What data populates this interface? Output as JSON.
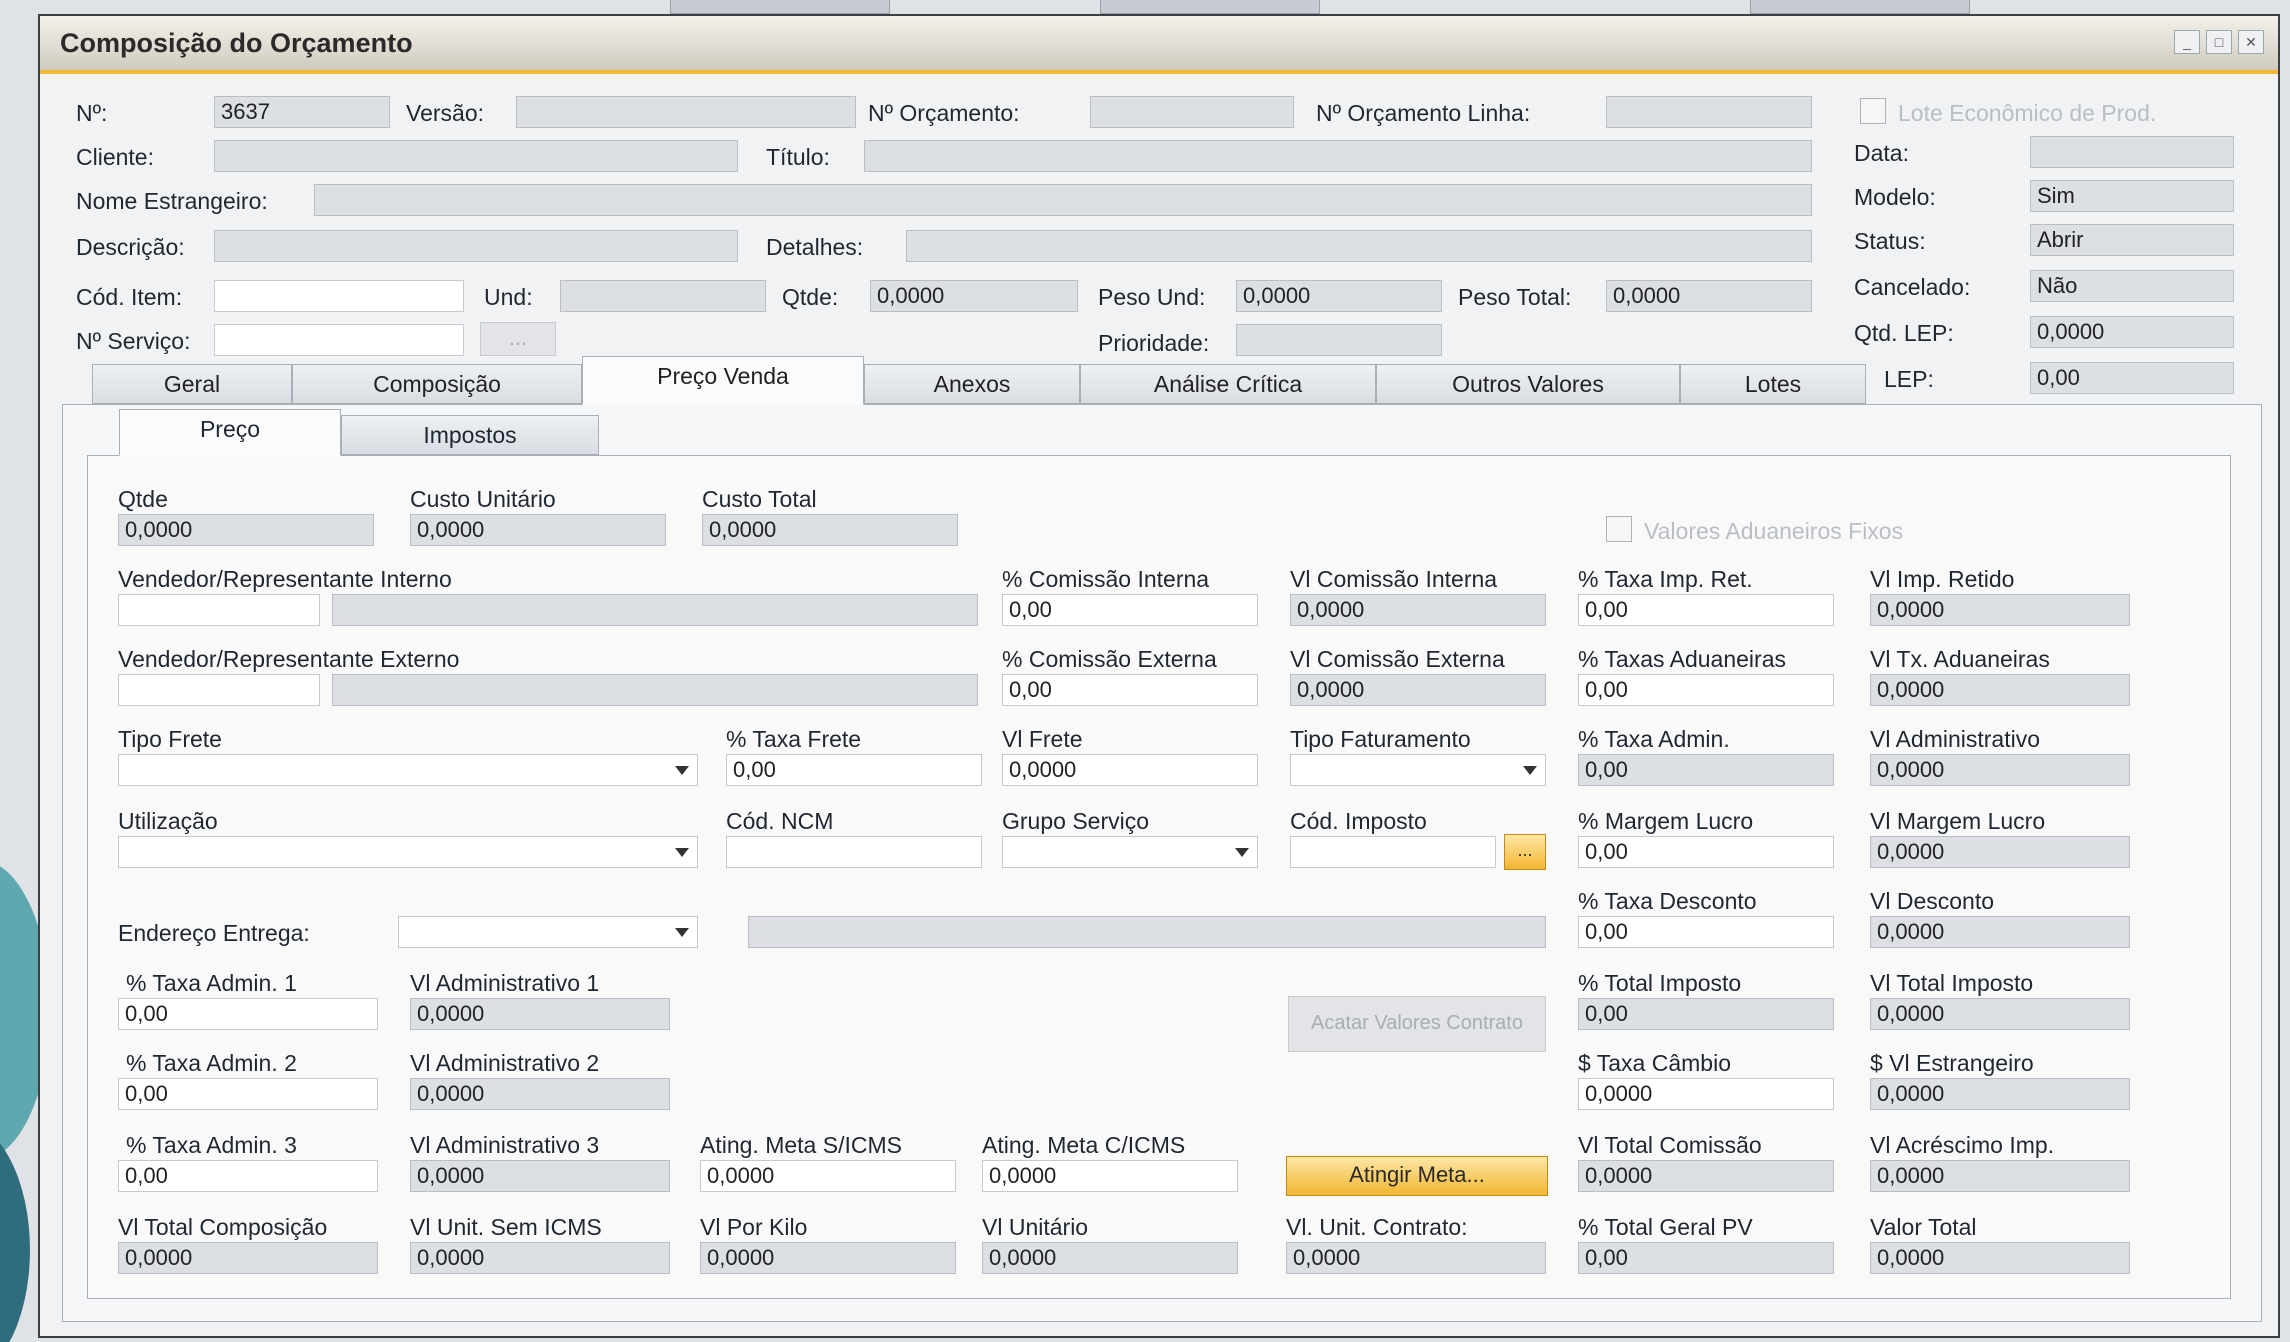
{
  "window": {
    "title": "Composição do Orçamento"
  },
  "header": {
    "num_label": "Nº:",
    "num_value": "3637",
    "versao_label": "Versão:",
    "versao_value": "",
    "num_orc_label": "Nº Orçamento:",
    "num_orc_value": "",
    "num_orc_linha_label": "Nº Orçamento Linha:",
    "num_orc_linha_value": "",
    "lote_label": "Lote Econômico de Prod.",
    "cliente_label": "Cliente:",
    "cliente_value": "",
    "titulo_label": "Título:",
    "titulo_value": "",
    "nome_estrangeiro_label": "Nome Estrangeiro:",
    "nome_estrangeiro_value": "",
    "descricao_label": "Descrição:",
    "descricao_value": "",
    "detalhes_label": "Detalhes:",
    "detalhes_value": "",
    "cod_item_label": "Cód. Item:",
    "cod_item_value": "",
    "und_label": "Und:",
    "und_value": "",
    "qtde_label": "Qtde:",
    "qtde_value": "0,0000",
    "peso_und_label": "Peso Und:",
    "peso_und_value": "0,0000",
    "peso_total_label": "Peso Total:",
    "peso_total_value": "0,0000",
    "num_servico_label": "Nº Serviço:",
    "num_servico_value": "",
    "servico_button": "...",
    "prioridade_label": "Prioridade:",
    "prioridade_value": ""
  },
  "right_panel": {
    "data_label": "Data:",
    "data_value": "",
    "modelo_label": "Modelo:",
    "modelo_value": "Sim",
    "status_label": "Status:",
    "status_value": "Abrir",
    "cancelado_label": "Cancelado:",
    "cancelado_value": "Não",
    "qtd_lep_label": "Qtd. LEP:",
    "qtd_lep_value": "0,0000",
    "lep_label": "LEP:",
    "lep_value": "0,00"
  },
  "tabs": [
    "Geral",
    "Composição",
    "Preço Venda",
    "Anexos",
    "Análise Crítica",
    "Outros Valores",
    "Lotes"
  ],
  "subtabs": [
    "Preço",
    "Impostos"
  ],
  "preco": {
    "qtde_label": "Qtde",
    "qtde_value": "0,0000",
    "custo_unit_label": "Custo Unitário",
    "custo_unit_value": "0,0000",
    "custo_total_label": "Custo Total",
    "custo_total_value": "0,0000",
    "valores_aduaneiros_label": "Valores Aduaneiros Fixos",
    "vend_int_label": "Vendedor/Representante Interno",
    "vend_int_code": "",
    "vend_int_name": "",
    "pct_com_int_label": "% Comissão Interna",
    "pct_com_int_value": "0,00",
    "vl_com_int_label": "Vl Comissão Interna",
    "vl_com_int_value": "0,0000",
    "pct_imp_ret_label": "% Taxa Imp. Ret.",
    "pct_imp_ret_value": "0,00",
    "vl_imp_ret_label": "Vl Imp. Retido",
    "vl_imp_ret_value": "0,0000",
    "vend_ext_label": "Vendedor/Representante Externo",
    "vend_ext_code": "",
    "vend_ext_name": "",
    "pct_com_ext_label": "% Comissão Externa",
    "pct_com_ext_value": "0,00",
    "vl_com_ext_label": "Vl Comissão Externa",
    "vl_com_ext_value": "0,0000",
    "pct_tx_adu_label": "% Taxas Aduaneiras",
    "pct_tx_adu_value": "0,00",
    "vl_tx_adu_label": "Vl Tx. Aduaneiras",
    "vl_tx_adu_value": "0,0000",
    "tipo_frete_label": "Tipo Frete",
    "tipo_frete_value": "",
    "pct_frete_label": "% Taxa Frete",
    "pct_frete_value": "0,00",
    "vl_frete_label": "Vl Frete",
    "vl_frete_value": "0,0000",
    "tipo_fat_label": "Tipo Faturamento",
    "tipo_fat_value": "",
    "pct_adm_label": "% Taxa Admin.",
    "pct_adm_value": "0,00",
    "vl_adm_label": "Vl Administrativo",
    "vl_adm_value": "0,0000",
    "utilizacao_label": "Utilização",
    "utilizacao_value": "",
    "ncm_label": "Cód. NCM",
    "ncm_value": "",
    "grupo_serv_label": "Grupo Serviço",
    "grupo_serv_value": "",
    "cod_imp_label": "Cód. Imposto",
    "cod_imp_value": "",
    "cod_imp_button": "...",
    "pct_margem_label": "% Margem Lucro",
    "pct_margem_value": "0,00",
    "vl_margem_label": "Vl Margem Lucro",
    "vl_margem_value": "0,0000",
    "pct_desc_label": "% Taxa Desconto",
    "pct_desc_value": "0,00",
    "vl_desc_label": "Vl Desconto",
    "vl_desc_value": "0,0000",
    "endereco_label": "Endereço Entrega:",
    "endereco_value": "",
    "endereco_text": "",
    "pct_adm1_label": "% Taxa Admin. 1",
    "pct_adm1_value": "0,00",
    "vl_adm1_label": "Vl Administrativo 1",
    "vl_adm1_value": "0,0000",
    "pct_adm2_label": "% Taxa Admin. 2",
    "pct_adm2_value": "0,00",
    "vl_adm2_label": "Vl Administrativo 2",
    "vl_adm2_value": "0,0000",
    "pct_adm3_label": "% Taxa Admin. 3",
    "pct_adm3_value": "0,00",
    "vl_adm3_label": "Vl Administrativo 3",
    "vl_adm3_value": "0,0000",
    "pct_total_imp_label": "% Total Imposto",
    "pct_total_imp_value": "0,00",
    "vl_total_imp_label": "Vl Total Imposto",
    "vl_total_imp_value": "0,0000",
    "tx_cambio_label": "$ Taxa Câmbio",
    "tx_cambio_value": "0,0000",
    "vl_estrangeiro_label": "$ Vl Estrangeiro",
    "vl_estrangeiro_value": "0,0000",
    "ating_sem_label": "Ating. Meta S/ICMS",
    "ating_sem_value": "0,0000",
    "ating_com_label": "Ating. Meta C/ICMS",
    "ating_com_value": "0,0000",
    "vl_total_com_label": "Vl Total Comissão",
    "vl_total_com_value": "0,0000",
    "vl_acresc_label": "Vl Acréscimo Imp.",
    "vl_acresc_value": "0,0000",
    "vl_total_comp_label": "Vl Total Composição",
    "vl_total_comp_value": "0,0000",
    "vl_unit_sem_label": "Vl Unit. Sem ICMS",
    "vl_unit_sem_value": "0,0000",
    "vl_kilo_label": "Vl Por Kilo",
    "vl_kilo_value": "0,0000",
    "vl_unitario_label": "Vl Unitário",
    "vl_unitario_value": "0,0000",
    "vl_unit_contrato_label": "Vl. Unit. Contrato:",
    "vl_unit_contrato_value": "0,0000",
    "pct_total_geral_label": "% Total Geral PV",
    "pct_total_geral_value": "0,00",
    "valor_total_label": "Valor Total",
    "valor_total_value": "0,0000",
    "acatar_button": "Acatar Valores Contrato",
    "atingir_button": "Atingir Meta..."
  }
}
